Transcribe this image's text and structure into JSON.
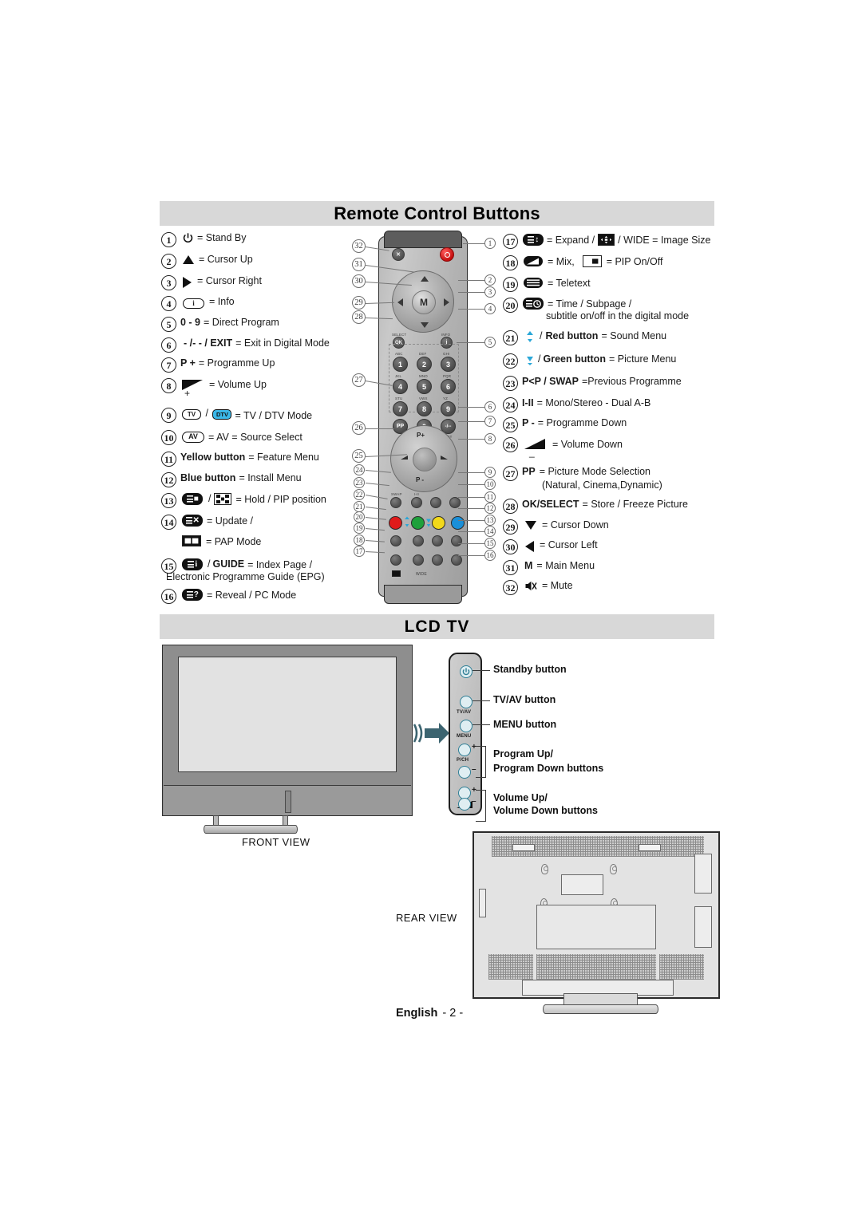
{
  "sections": {
    "remote": {
      "title": "Remote Control Buttons"
    },
    "lcd": {
      "title": "LCD TV"
    }
  },
  "remote_buttons_left": [
    {
      "n": "1",
      "icon": "power-icon",
      "text": "= Stand By"
    },
    {
      "n": "2",
      "icon": "triangle-up-icon",
      "text": "= Cursor Up"
    },
    {
      "n": "3",
      "icon": "triangle-right-icon",
      "text": "= Cursor Right"
    },
    {
      "n": "4",
      "icon": "info-icon",
      "text": "= Info"
    },
    {
      "n": "5",
      "icon": "digits-0-9",
      "bold": "0 - 9",
      "text": "= Direct Program"
    },
    {
      "n": "6",
      "icon": "exit-icon",
      "bold": "- /- - / EXIT",
      "text": "= Exit in Digital Mode"
    },
    {
      "n": "7",
      "icon": "p-plus-icon",
      "bold": "P +",
      "text": "= Programme Up"
    },
    {
      "n": "8",
      "icon": "volume-up-wedge-icon",
      "text": "=  Volume Up",
      "sub": "+"
    },
    {
      "n": "9",
      "icon": "tv-dtv-icon",
      "text": "= TV / DTV Mode"
    },
    {
      "n": "10",
      "icon": "av-icon",
      "text": "= AV = Source Select",
      "bold": "AV"
    },
    {
      "n": "11",
      "icon": "yellow-button-icon",
      "bold": "Yellow button",
      "text": "= Feature Menu"
    },
    {
      "n": "12",
      "icon": "blue-button-icon",
      "bold": "Blue button",
      "text": "= Install Menu"
    },
    {
      "n": "13",
      "icon": "hold-pip-icon",
      "text": "= Hold / PIP position"
    },
    {
      "n": "14",
      "icon": "update-pap-icon",
      "text": "= Update /",
      "sub": "= PAP Mode"
    },
    {
      "n": "15",
      "icon": "index-guide-icon",
      "bold": "GUIDE",
      "text": "= Index Page /",
      "sub": "Electronic Programme Guide (EPG)"
    },
    {
      "n": "16",
      "icon": "reveal-pc-icon",
      "text": "= Reveal /  PC Mode"
    }
  ],
  "remote_buttons_right": [
    {
      "n": "17",
      "icon": "expand-icon",
      "text": "= Expand /",
      "text2": "/ WIDE = Image Size",
      "bold": "WIDE"
    },
    {
      "n": "18",
      "icon": "mix-icon",
      "text": "= Mix,",
      "text2": "= PIP On/Off"
    },
    {
      "n": "19",
      "icon": "teletext-icon",
      "text": "= Teletext"
    },
    {
      "n": "20",
      "icon": "time-subpage-icon",
      "text": "= Time / Subpage /",
      "sub": "subtitle on/off in the digital mode"
    },
    {
      "n": "21",
      "icon": "red-button-icon",
      "bold": "Red button",
      "text": "= Sound Menu",
      "pre": "/"
    },
    {
      "n": "22",
      "icon": "green-button-icon",
      "bold": "Green button",
      "text": "= Picture Menu",
      "pre": "/"
    },
    {
      "n": "23",
      "icon": "swap-icon",
      "bold": "P<P / SWAP",
      "text": "=Previous Programme"
    },
    {
      "n": "24",
      "icon": "mono-stereo-icon",
      "bold": "I-II",
      "text": "= Mono/Stereo - Dual A-B"
    },
    {
      "n": "25",
      "icon": "p-minus-icon",
      "bold": "P -",
      "text": "= Programme Down"
    },
    {
      "n": "26",
      "icon": "volume-down-wedge-icon",
      "text": "=  Volume Down",
      "sub": "_"
    },
    {
      "n": "27",
      "icon": "pp-icon",
      "bold": "PP",
      "text": "= Picture Mode Selection",
      "sub": "(Natural, Cinema,Dynamic)"
    },
    {
      "n": "28",
      "icon": "ok-select-icon",
      "bold": "OK/SELECT",
      "text": "= Store / Freeze Picture"
    },
    {
      "n": "29",
      "icon": "triangle-down-icon",
      "text": "= Cursor Down"
    },
    {
      "n": "30",
      "icon": "triangle-left-icon",
      "text": "= Cursor Left"
    },
    {
      "n": "31",
      "icon": "main-menu-icon",
      "bold": "M",
      "text": "= Main Menu"
    },
    {
      "n": "32",
      "icon": "mute-icon",
      "text": "= Mute"
    }
  ],
  "remote_art": {
    "center_key": "M",
    "numpad": [
      "1",
      "2",
      "3",
      "4",
      "5",
      "6",
      "7",
      "8",
      "9",
      "PP",
      "0",
      "-/--"
    ],
    "numpad_letters": [
      "ABC",
      "DEF",
      "GHI",
      "JKL",
      "MNO",
      "PQR",
      "STU",
      "VWX",
      "YZ"
    ],
    "wheel_top": "P+",
    "wheel_bottom": "P -",
    "exit_label": "EXIT",
    "info_label": "INFO",
    "select_label": "SELECT",
    "ok_label": "OK",
    "swap_label": "SWAP",
    "mono_label": "I-II",
    "callouts_left": [
      "32",
      "31",
      "30",
      "29",
      "28",
      "27",
      "26",
      "25",
      "24",
      "23",
      "22",
      "21",
      "20",
      "19",
      "18",
      "17"
    ],
    "callouts_right": [
      "1",
      "2",
      "3",
      "4",
      "5",
      "6",
      "7",
      "8",
      "9",
      "10",
      "11",
      "12",
      "13",
      "14",
      "15",
      "16"
    ]
  },
  "lcd_tv": {
    "front_view_label": "FRONT VIEW",
    "rear_view_label": "REAR VIEW",
    "panel_labels": [
      {
        "name": "standby",
        "text": "Standby button"
      },
      {
        "name": "tv-av",
        "text": "TV/AV button"
      },
      {
        "name": "menu",
        "text": "MENU button"
      },
      {
        "name": "program",
        "text": "Program Up/",
        "text2": "Program Down buttons"
      },
      {
        "name": "volume",
        "text": "Volume Up/",
        "text2": "Volume Down buttons"
      }
    ],
    "panel_small_labels": {
      "tvav": "TV/AV",
      "menu": "MENU",
      "pch": "P/CH",
      "plus": "+",
      "minus": "–"
    }
  },
  "footer": {
    "language": "English",
    "page": "- 2 -"
  },
  "colors": {
    "header_bar": "#d8d8d8",
    "red_button": "#e01b1b",
    "green_button": "#1ea03b",
    "yellow_button": "#f2d81a",
    "blue_button": "#1a8fd8",
    "dtv_badge": "#3bb7e8",
    "cyan_arrow": "#2aa7d8",
    "ir_arrow": "#3c6470"
  }
}
